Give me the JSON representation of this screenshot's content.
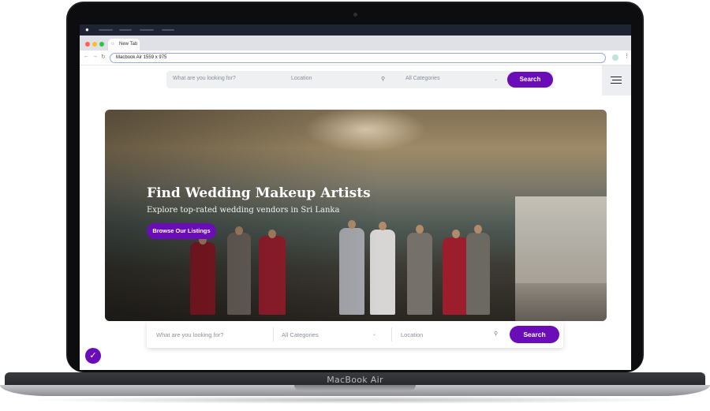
{
  "device": {
    "brand_label": "MacBook Air"
  },
  "browser": {
    "tab_title": "New Tab",
    "address": "Macbook Air  1559 x 975"
  },
  "header": {
    "search_placeholder": "What are you looking for?",
    "location_placeholder": "Location",
    "category_selected": "All Categories",
    "search_button": "Search"
  },
  "hero": {
    "title": "Find Wedding Makeup Artists",
    "subtitle": "Explore top-rated wedding vendors in Sri Lanka",
    "cta": "Browse Our Listings"
  },
  "bottom_search": {
    "search_placeholder": "What are you looking for?",
    "category_selected": "All Categories",
    "location_placeholder": "Location",
    "search_button": "Search"
  },
  "colors": {
    "accent": "#6a0db8"
  }
}
